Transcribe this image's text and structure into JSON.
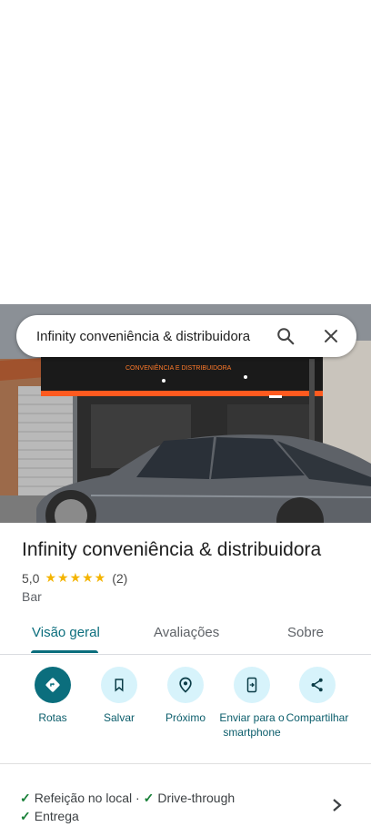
{
  "search": {
    "value": "Infinity conveniência & distribuidora"
  },
  "photo": {
    "sign_text": "CONVENIÊNCIA E DISTRIBUIDORA"
  },
  "place": {
    "name": "Infinity conveniência & distribuidora",
    "rating": "5,0",
    "stars": "★★★★★",
    "review_count": "(2)",
    "category": "Bar"
  },
  "tabs": [
    {
      "label": "Visão geral"
    },
    {
      "label": "Avaliações"
    },
    {
      "label": "Sobre"
    }
  ],
  "actions": [
    {
      "label": "Rotas",
      "icon": "directions-icon"
    },
    {
      "label": "Salvar",
      "icon": "bookmark-icon"
    },
    {
      "label": "Próximo",
      "icon": "nearby-icon"
    },
    {
      "label": "Enviar para o smartphone",
      "icon": "send-to-phone-icon"
    },
    {
      "label": "Compartilhar",
      "icon": "share-icon"
    }
  ],
  "attributes": {
    "item1": "Refeição no local",
    "separator": "·",
    "item2": "Drive-through",
    "item3": "Entrega"
  },
  "colors": {
    "accent": "#0b6e7d",
    "action_bg": "#d7f3fb",
    "star": "#f4b400",
    "check": "#188038"
  }
}
